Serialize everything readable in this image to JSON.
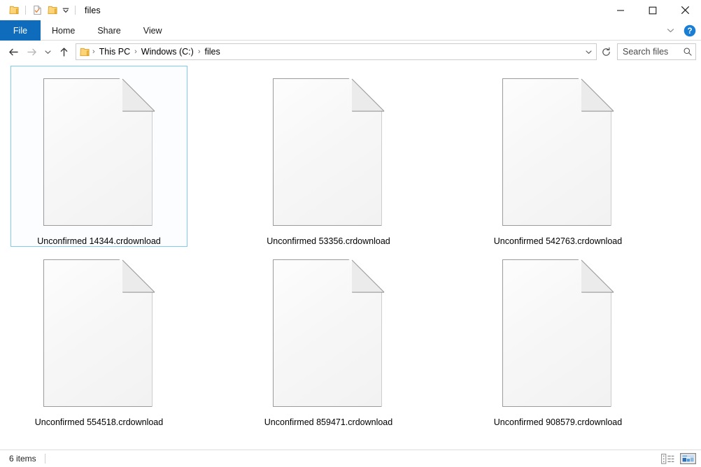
{
  "window": {
    "title": "files",
    "quick_access": [
      {
        "name": "folder-properties-icon",
        "icon": "folder-icon"
      },
      {
        "name": "folder-checkmark-icon",
        "icon": "document-check-icon"
      },
      {
        "name": "new-folder-icon",
        "icon": "folder-icon"
      }
    ],
    "controls": {
      "minimize": "–",
      "maximize": "□",
      "close": "✕"
    }
  },
  "ribbon": {
    "tabs": [
      {
        "label": "File",
        "active": true
      },
      {
        "label": "Home",
        "active": false
      },
      {
        "label": "Share",
        "active": false
      },
      {
        "label": "View",
        "active": false
      }
    ],
    "expand_label": "⌄",
    "help_label": "?"
  },
  "address": {
    "back_label": "←",
    "forward_label": "→",
    "recent_label": "⌄",
    "up_label": "↑",
    "breadcrumbs": [
      "This PC",
      "Windows (C:)",
      "files"
    ],
    "separator": "›",
    "dropdown_label": "⌄",
    "refresh_label": "⟳"
  },
  "search": {
    "placeholder": "Search files",
    "value": ""
  },
  "files": [
    {
      "name": "Unconfirmed 14344.crdownload",
      "selected": true
    },
    {
      "name": "Unconfirmed 53356.crdownload",
      "selected": false
    },
    {
      "name": "Unconfirmed 542763.crdownload",
      "selected": false
    },
    {
      "name": "Unconfirmed 554518.crdownload",
      "selected": false
    },
    {
      "name": "Unconfirmed 859471.crdownload",
      "selected": false
    },
    {
      "name": "Unconfirmed 908579.crdownload",
      "selected": false
    }
  ],
  "status": {
    "item_count": "6 items",
    "views": [
      {
        "name": "details-view",
        "active": false
      },
      {
        "name": "large-icons-view",
        "active": true
      }
    ]
  },
  "colors": {
    "file_tab_blue": "#0f6cbd",
    "selection_border": "#7fcbef",
    "selection_fill": "#fbfdff",
    "folder_yellow": "#fcc24c",
    "help_blue": "#1a7fd4"
  }
}
